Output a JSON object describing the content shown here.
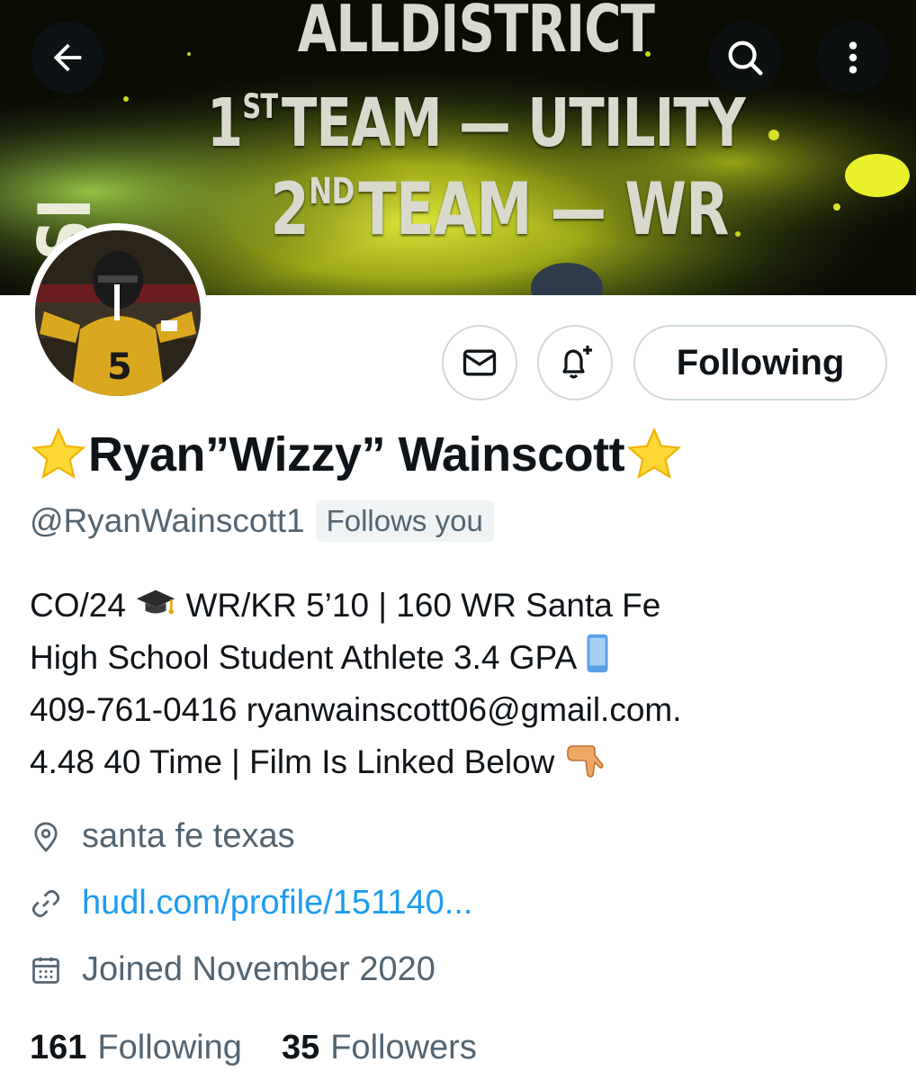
{
  "banner": {
    "line1": "ALLDISTRICT",
    "line2_sup": "ST",
    "line2_pre": "1",
    "line2_rest": "TEAM — UTILITY",
    "line3_pre": "2",
    "line3_sup": "ND",
    "line3_rest": "TEAM — WR",
    "side_text": "SI"
  },
  "icons": {
    "back": "arrow-left-icon",
    "search": "search-icon",
    "more": "more-vertical-icon",
    "message": "envelope-icon",
    "notify": "bell-plus-icon",
    "location": "location-pin-icon",
    "link": "link-icon",
    "calendar": "calendar-icon"
  },
  "actions": {
    "follow_label": "Following"
  },
  "profile": {
    "display_name": "Ryan”Wizzy” Wainscott",
    "handle": "@RyanWainscott1",
    "follows_you": "Follows you",
    "bio": {
      "line1_a": "CO/24",
      "line1_b": "WR/KR 5’10 | 160 WR Santa Fe",
      "line2": "High School Student Athlete 3.4 GPA",
      "line3": "409-761-0416 ryanwainscott06@gmail.com.",
      "line4": "4.48 40 Time | Film Is Linked Below"
    },
    "location": "santa fe texas",
    "website": "hudl.com/profile/151140...",
    "joined": "Joined November 2020",
    "following_count": "161",
    "following_label": "Following",
    "followers_count": "35",
    "followers_label": "Followers"
  },
  "colors": {
    "accent_link": "#1d9bf0",
    "secondary_text": "#536471",
    "primary_text": "#0f1419",
    "border": "#cfd9de"
  }
}
